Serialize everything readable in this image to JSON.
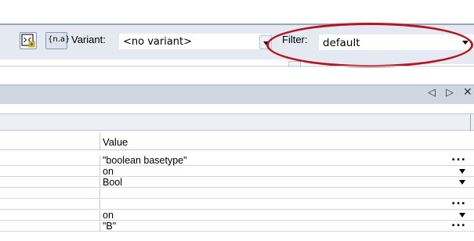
{
  "toolbar": {
    "variant_label": "Variant:",
    "variant_value": "<no variant>",
    "filter_label": "Filter:",
    "filter_value": "default",
    "add_icon": "add-window-icon",
    "na_icon": "na-icon",
    "na_text": "{n.a}"
  },
  "panel": {
    "scroll_left": "◁",
    "scroll_right": "▷",
    "close": "✕"
  },
  "grid": {
    "value_header": "Value",
    "rows": [
      {
        "value": "\"boolean basetype\"",
        "control": "ellipsis"
      },
      {
        "value": "on",
        "control": "dropdown"
      },
      {
        "value": "Bool",
        "control": "dropdown"
      },
      {
        "value": "",
        "control": "ellipsis"
      },
      {
        "value": "on",
        "control": "dropdown"
      },
      {
        "value": "\"B\"",
        "control": "ellipsis"
      }
    ],
    "ellipsis_text": "..."
  },
  "annotation": {
    "highlight_color": "#b5151f"
  }
}
